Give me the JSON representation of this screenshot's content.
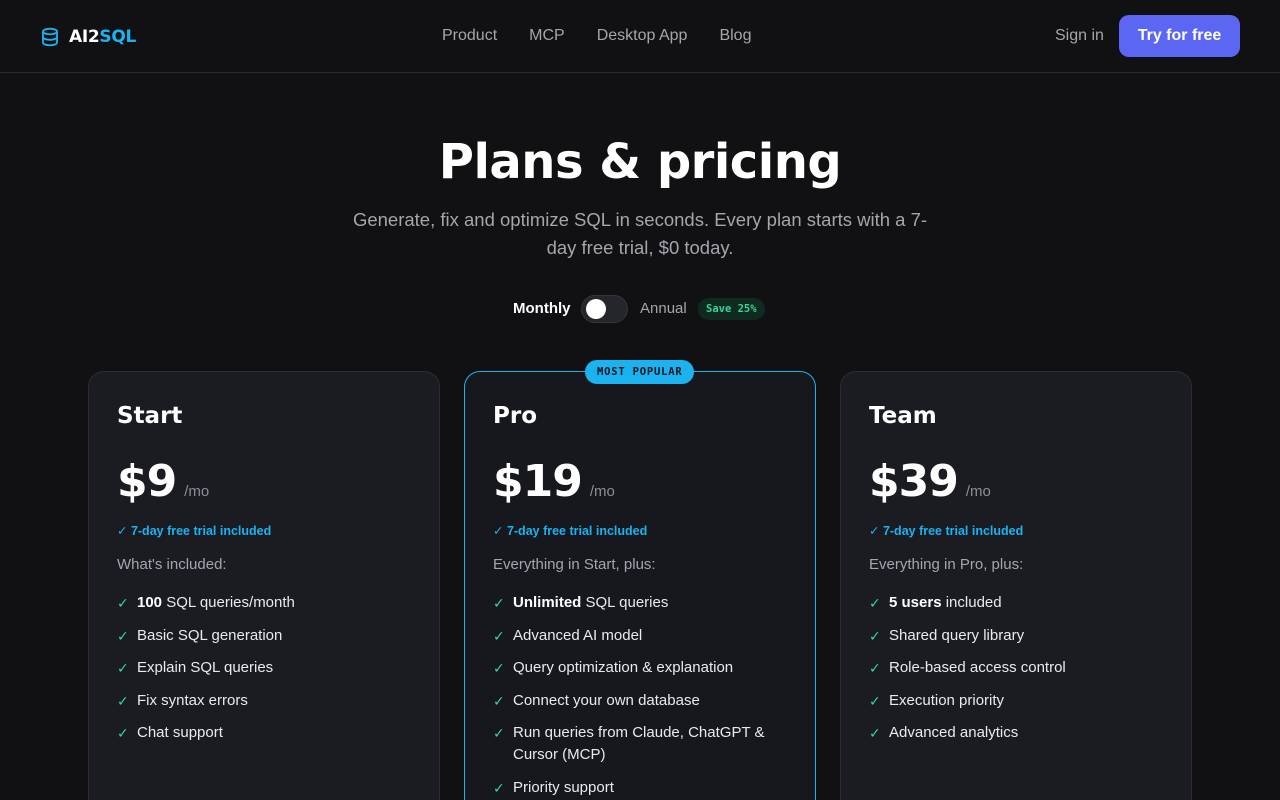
{
  "brand": {
    "part1": "AI2",
    "part2": "SQL",
    "icon": "database-icon",
    "accent": "#1ab3f0"
  },
  "nav": {
    "links": [
      "Product",
      "MCP",
      "Desktop App",
      "Blog"
    ],
    "signin": "Sign in",
    "cta": "Try for free",
    "cta_color": "#5b67f2"
  },
  "hero": {
    "title": "Plans & pricing",
    "subtitle": "Generate, fix and optimize SQL in seconds. Every plan starts with a 7-day free trial, $0 today."
  },
  "billing": {
    "monthly": "Monthly",
    "annual": "Annual",
    "save": "Save 25%",
    "selected": "Monthly"
  },
  "plans": [
    {
      "name": "Start",
      "price": "$9",
      "per": "/mo",
      "trial": "✓ 7-day free trial included",
      "intro": "What's included:",
      "features": [
        {
          "bold": "100",
          "text": " SQL queries/month"
        },
        {
          "bold": "",
          "text": "Basic SQL generation"
        },
        {
          "bold": "",
          "text": "Explain SQL queries"
        },
        {
          "bold": "",
          "text": "Fix syntax errors"
        },
        {
          "bold": "",
          "text": "Chat support"
        }
      ]
    },
    {
      "name": "Pro",
      "badge": "MOST POPULAR",
      "price": "$19",
      "per": "/mo",
      "trial": "✓ 7-day free trial included",
      "intro": "Everything in Start, plus:",
      "features": [
        {
          "bold": "Unlimited",
          "text": " SQL queries"
        },
        {
          "bold": "",
          "text": "Advanced AI model"
        },
        {
          "bold": "",
          "text": "Query optimization & explanation"
        },
        {
          "bold": "",
          "text": "Connect your own database"
        },
        {
          "bold": "",
          "text": "Run queries from Claude, ChatGPT & Cursor (MCP)"
        },
        {
          "bold": "",
          "text": "Priority support"
        }
      ]
    },
    {
      "name": "Team",
      "price": "$39",
      "per": "/mo",
      "trial": "✓ 7-day free trial included",
      "intro": "Everything in Pro, plus:",
      "features": [
        {
          "bold": "5 users",
          "text": " included"
        },
        {
          "bold": "",
          "text": "Shared query library"
        },
        {
          "bold": "",
          "text": "Role-based access control"
        },
        {
          "bold": "",
          "text": "Execution priority"
        },
        {
          "bold": "",
          "text": "Advanced analytics"
        }
      ]
    }
  ],
  "check_icon": "check-icon",
  "check_color": "#35d49a"
}
